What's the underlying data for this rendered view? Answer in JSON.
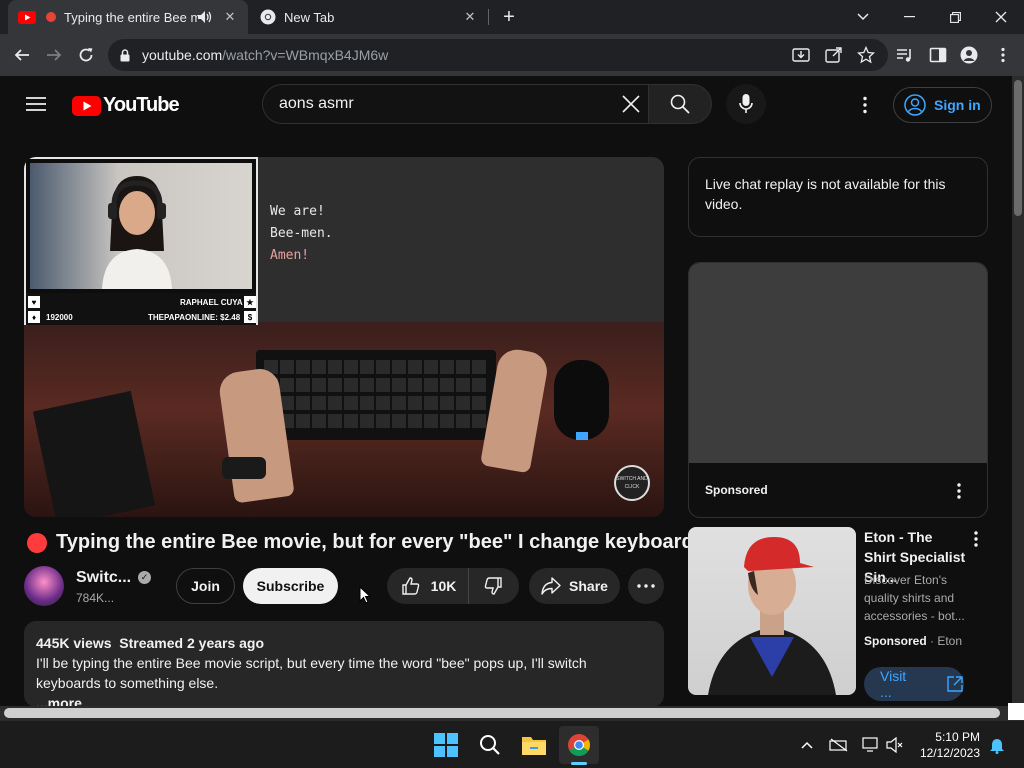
{
  "browser": {
    "tabs": [
      {
        "title": "Typing the entire Bee mo",
        "active": true
      },
      {
        "title": "New Tab",
        "active": false
      }
    ],
    "url_host": "youtube.com",
    "url_path": "/watch?v=WBmqxB4JM6w"
  },
  "youtube": {
    "logo_text": "YouTube",
    "search_value": "aons asmr",
    "sign_in_label": "Sign in"
  },
  "player": {
    "overlay_lines": [
      "We are!",
      "Bee-men.",
      "Amen!"
    ],
    "donor_name": "RAPHAEL CUYA",
    "follower_count": "192000",
    "donation": "THEPAPAONLINE: $2.48",
    "channel_logo_text": "SWITCH AND CLICK"
  },
  "video": {
    "title": "Typing the entire Bee movie, but for every \"bee\" I change keyboards",
    "channel_name": "Switc...",
    "subscribers": "784K...",
    "join_label": "Join",
    "subscribe_label": "Subscribe",
    "like_count": "10K",
    "share_label": "Share"
  },
  "description": {
    "views": "445K views",
    "streamed": "Streamed 2 years ago",
    "text": "I'll be typing the entire Bee movie script, but every time the word \"bee\" pops up, I'll switch keyboards to something else.",
    "more_label": "...more"
  },
  "sidebar": {
    "chat_replay": "Live chat replay is not available for this video.",
    "ad_sponsored": "Sponsored",
    "promo": {
      "title": "Eton - The Shirt Specialist Sin...",
      "description": "Discover Eton's quality shirts and accessories - bot...",
      "sponsored": "Sponsored",
      "advertiser": "Eton",
      "visit_label": "Visit ..."
    }
  },
  "taskbar": {
    "time": "5:10 PM",
    "date": "12/12/2023"
  },
  "colors": {
    "youtube_red": "#ff0000",
    "link_blue": "#3ea6ff",
    "background": "#0f0f0f"
  }
}
